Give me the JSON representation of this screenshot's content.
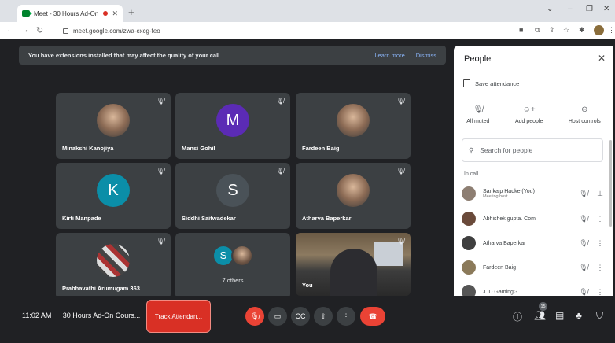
{
  "browser": {
    "tab_title": "Meet - 30 Hours Ad-On Co...",
    "url": "meet.google.com/zwa-cxcg-feo"
  },
  "banner": {
    "message": "You have extensions installed that may affect the quality of your call",
    "learn_more": "Learn more",
    "dismiss": "Dismiss"
  },
  "tiles": [
    {
      "name": "Minakshi Kanojiya"
    },
    {
      "name": "Mansi Gohil",
      "initial": "M",
      "color": "#5b2bb5"
    },
    {
      "name": "Fardeen Baig"
    },
    {
      "name": "Kirti Manpade",
      "initial": "K",
      "color": "#0b8ea8"
    },
    {
      "name": "Siddhi Saitwadekar",
      "initial": "S",
      "color": "#4a5258"
    },
    {
      "name": "Atharva Baperkar"
    },
    {
      "name": "Prabhavathi Arumugam 363"
    },
    {
      "name": "7 others",
      "initial": "S",
      "color": "#0b8ea8"
    },
    {
      "name": "You"
    }
  ],
  "bottom": {
    "time": "11:02 AM",
    "meeting_name": "30 Hours Ad-On Cours...",
    "track_button": "Track Attendan...",
    "participant_count": "15"
  },
  "panel": {
    "title": "People",
    "save_attendance": "Save attendance",
    "actions": [
      "All muted",
      "Add people",
      "Host controls"
    ],
    "search_placeholder": "Search for people",
    "section": "In call",
    "people": [
      {
        "name": "Sankalp Hadke (You)",
        "sub": "Meeting host"
      },
      {
        "name": "Abhishek gupta. Com",
        "sub": ""
      },
      {
        "name": "Atharva Baperkar",
        "sub": ""
      },
      {
        "name": "Fardeen Baig",
        "sub": ""
      },
      {
        "name": "J. D GamingG",
        "sub": ""
      }
    ]
  },
  "colors": {
    "meet_bg": "#202124",
    "tile_bg": "#3c4043",
    "red": "#ea4335",
    "link": "#8ab4f8"
  }
}
